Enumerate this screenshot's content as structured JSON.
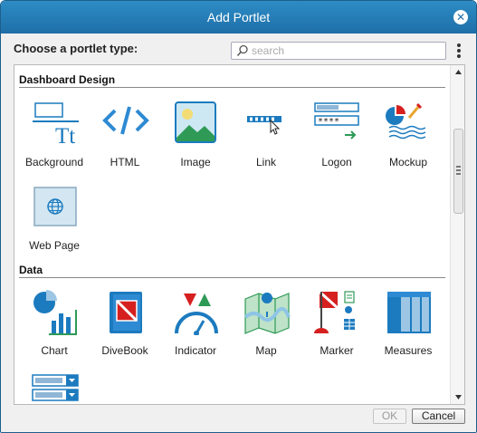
{
  "dialog": {
    "title": "Add Portlet",
    "close_icon": "close-icon",
    "choose_label": "Choose a portlet type:",
    "search": {
      "value": "",
      "placeholder": "search",
      "icon": "search-icon"
    },
    "menu_icon": "vertical-dots-icon"
  },
  "sections": [
    {
      "title": "Dashboard Design",
      "items": [
        {
          "label": "Background",
          "icon": "background-icon"
        },
        {
          "label": "HTML",
          "icon": "code-icon"
        },
        {
          "label": "Image",
          "icon": "image-icon"
        },
        {
          "label": "Link",
          "icon": "link-icon"
        },
        {
          "label": "Logon",
          "icon": "logon-icon"
        },
        {
          "label": "Mockup",
          "icon": "mockup-icon"
        },
        {
          "label": "Web Page",
          "icon": "web-page-icon"
        }
      ]
    },
    {
      "title": "Data",
      "items": [
        {
          "label": "Chart",
          "icon": "chart-icon"
        },
        {
          "label": "DiveBook",
          "icon": "divebook-icon"
        },
        {
          "label": "Indicator",
          "icon": "indicator-icon"
        },
        {
          "label": "Map",
          "icon": "map-icon"
        },
        {
          "label": "Marker",
          "icon": "marker-icon"
        },
        {
          "label": "Measures",
          "icon": "measures-icon"
        },
        {
          "label": "",
          "icon": "selector-icon"
        }
      ]
    }
  ],
  "buttons": {
    "ok": "OK",
    "cancel": "Cancel"
  },
  "colors": {
    "title_bar": "#1f6fa8",
    "accent": "#2d8cc5",
    "icon_blue": "#1c7bbf",
    "icon_red": "#d62020",
    "icon_green": "#2e9a56"
  }
}
